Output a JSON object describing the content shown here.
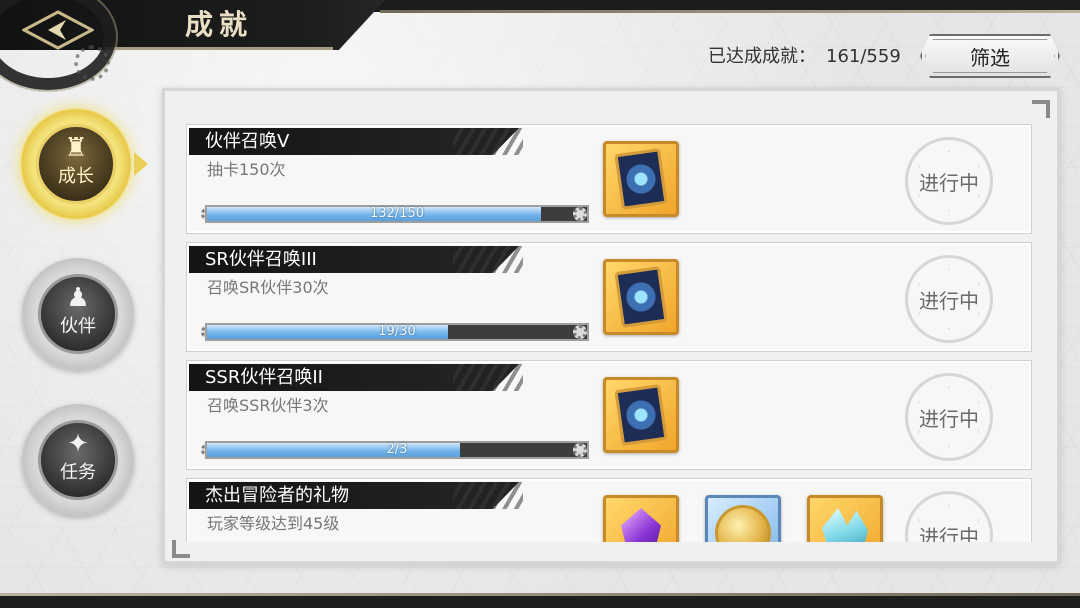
{
  "header": {
    "title": "成就",
    "back_icon": "back-arrow-icon",
    "progress_label": "已达成成就：",
    "progress_value": "161/559",
    "filter_label": "筛选"
  },
  "sidebar": {
    "items": [
      {
        "label": "成长",
        "icon": "hooded-figure-icon",
        "active": true
      },
      {
        "label": "伙伴",
        "icon": "group-icon",
        "active": false
      },
      {
        "label": "任务",
        "icon": "book-flame-icon",
        "active": false
      }
    ]
  },
  "achievements": [
    {
      "name": "伙伴召唤V",
      "desc": "抽卡150次",
      "progress_text": "132/150",
      "progress": 0.88,
      "rewards": [
        "summon-card-icon"
      ],
      "status": "进行中"
    },
    {
      "name": "SR伙伴召唤III",
      "desc": "召唤SR伙伴30次",
      "progress_text": "19/30",
      "progress": 0.633,
      "rewards": [
        "summon-card-icon"
      ],
      "status": "进行中"
    },
    {
      "name": "SSR伙伴召唤II",
      "desc": "召唤SSR伙伴3次",
      "progress_text": "2/3",
      "progress": 0.667,
      "rewards": [
        "summon-card-icon"
      ],
      "status": "进行中"
    },
    {
      "name": "杰出冒险者的礼物",
      "desc": "玩家等级达到45级",
      "progress_text": "",
      "progress": 0,
      "rewards": [
        "purple-gem-icon",
        "gold-coin-icon",
        "crystal-icon"
      ],
      "status": "进行中"
    }
  ]
}
